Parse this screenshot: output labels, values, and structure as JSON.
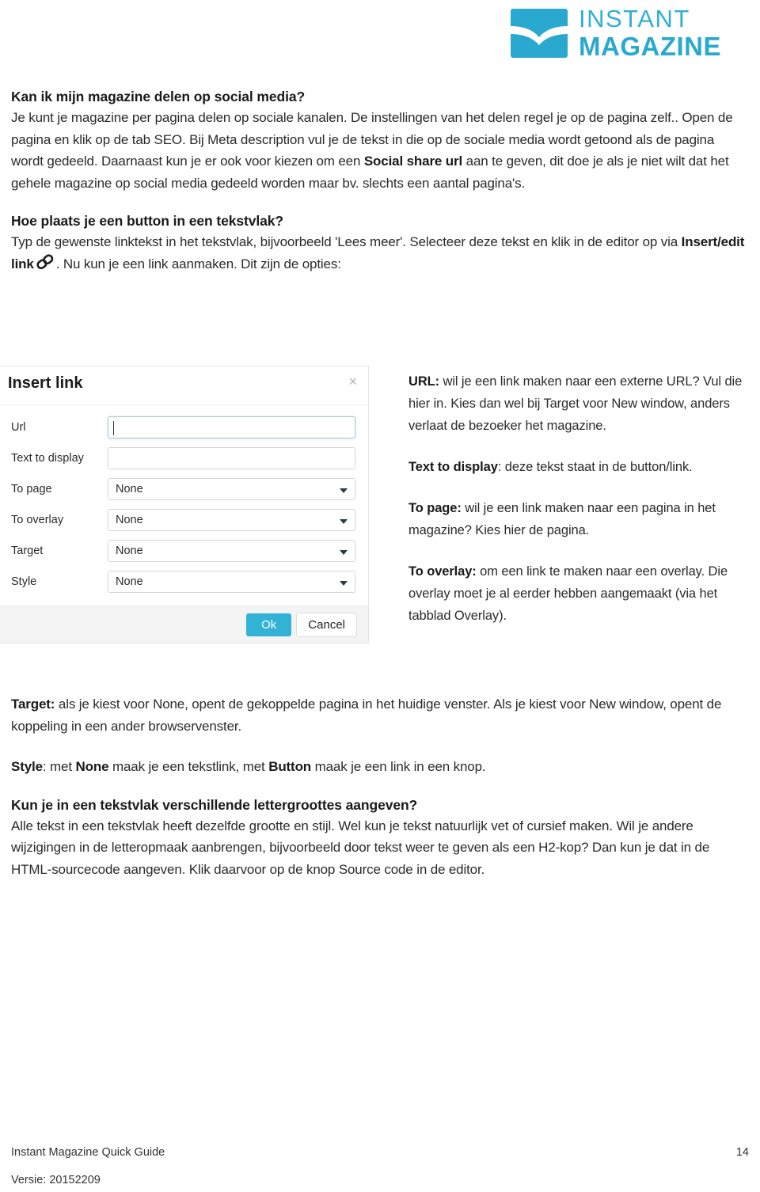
{
  "logo": {
    "icon_name": "open-book-icon",
    "line1": "INSTANT",
    "line2": "MAGAZINE",
    "color": "#29A9CF"
  },
  "section1": {
    "heading": "Kan ik mijn magazine delen op social media?",
    "para_part1": "Je kunt je magazine per pagina delen op sociale kanalen. De instellingen van het delen regel je op de pagina zelf.. Open de pagina en klik op de tab SEO. Bij Meta description vul je de tekst in die op de sociale media wordt getoond als de pagina wordt gedeeld. Daarnaast kun je er ook voor kiezen om een ",
    "para_bold1": "Social share url",
    "para_part2": " aan te geven, dit doe je als je niet wilt dat het gehele magazine op social media gedeeld worden maar bv. slechts een aantal pagina's."
  },
  "section2": {
    "heading": "Hoe plaats je een button in een tekstvlak?",
    "para_part1": "Typ de gewenste linktekst in het tekstvlak, bijvoorbeeld 'Lees meer'. Selecteer deze tekst en klik in de editor op via ",
    "para_bold1": "Insert/edit link",
    "icon_name": "chain-link-icon",
    "para_part2": ". Nu kun je een link aanmaken. Dit zijn de opties:"
  },
  "dialog": {
    "title": "Insert link",
    "close_label": "×",
    "fields": [
      {
        "label": "Url",
        "type": "text",
        "value": "",
        "focused": true
      },
      {
        "label": "Text to display",
        "type": "text",
        "value": "",
        "focused": false
      },
      {
        "label": "To page",
        "type": "select",
        "value": "None"
      },
      {
        "label": "To overlay",
        "type": "select",
        "value": "None"
      },
      {
        "label": "Target",
        "type": "select",
        "value": "None"
      },
      {
        "label": "Style",
        "type": "select",
        "value": "None"
      }
    ],
    "ok_label": "Ok",
    "cancel_label": "Cancel",
    "ok_color": "#32B2D4"
  },
  "sidenotes": [
    {
      "term": "URL:",
      "text": " wil je een link maken naar een externe URL? Vul die hier in. Kies dan wel bij Target voor New window, anders verlaat de bezoeker het magazine."
    },
    {
      "term": "Text to display",
      "text": ": deze tekst staat in de button/link."
    },
    {
      "term": "To page:",
      "text": " wil je een link maken naar een pagina in het magazine? Kies hier de pagina."
    },
    {
      "term": "To overlay:",
      "text": " om een link te maken naar een overlay. Die overlay moet je al eerder hebben aangemaakt (via het tabblad Overlay)."
    }
  ],
  "lower": {
    "target_term": "Target:",
    "target_text": " als je kiest voor None, opent de gekoppelde pagina in het huidige venster. Als je kiest voor New window, opent de koppeling in een ander browservenster.",
    "style_term": "Style",
    "style_part1": ": met ",
    "style_bold1": "None",
    "style_part2": " maak je een tekstlink, met ",
    "style_bold2": "Button",
    "style_part3": " maak je een link in een knop.",
    "heading3": "Kun je in een tekstvlak verschillende lettergroottes aangeven?",
    "para3": "Alle tekst in een tekstvlak heeft dezelfde grootte en stijl. Wel kun je tekst natuurlijk vet of cursief maken. Wil je andere wijzigingen in de letteropmaak aanbrengen, bijvoorbeeld door tekst weer te geven als een H2-kop? Dan kun je dat in de HTML-sourcecode aangeven. Klik daarvoor op de knop Source code in de editor."
  },
  "footer": {
    "doc_title": "Instant Magazine Quick Guide",
    "page_number": "14",
    "version": "Versie: 20152209"
  }
}
